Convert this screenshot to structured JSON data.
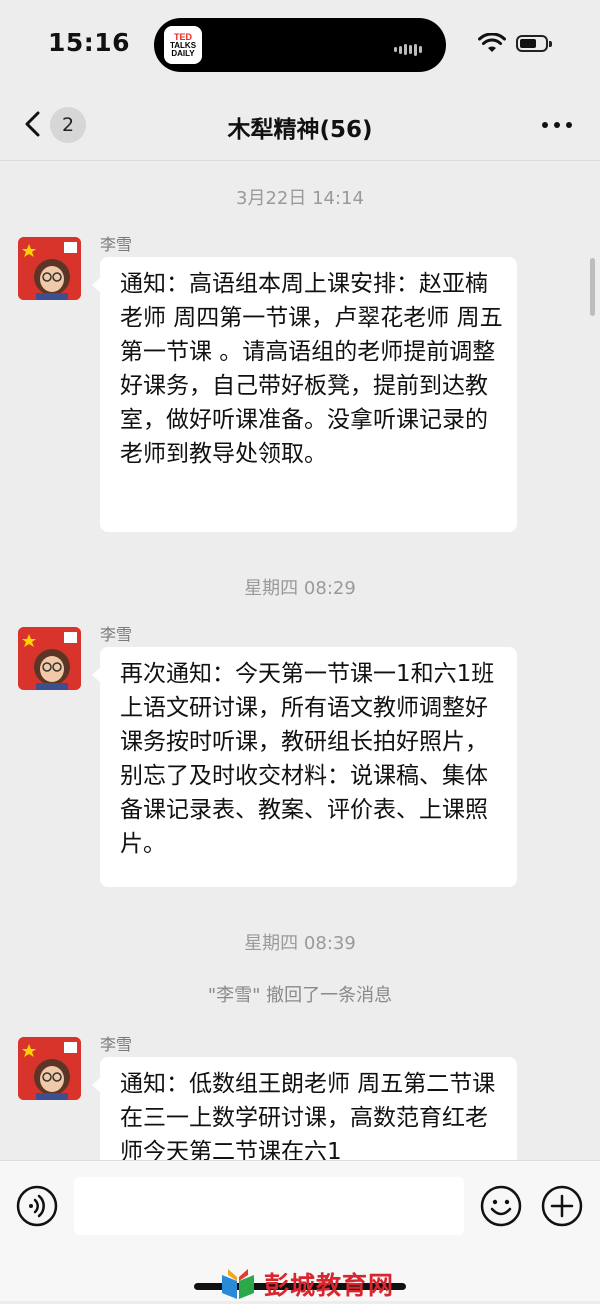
{
  "status_bar": {
    "time": "15:16",
    "island_logo": [
      "TED",
      "TALKS",
      "DAILY"
    ]
  },
  "header": {
    "back_badge": "2",
    "title": "木犁精神(56)"
  },
  "messages": [
    {
      "timestamp": "3月22日 14:14",
      "sender": "李雪",
      "text": "通知：高语组本周上课安排：赵亚楠老师 周四第一节课，卢翠花老师 周五第一节课 。请高语组的老师提前调整好课务，自己带好板凳，提前到达教室，做好听课准备。没拿听课记录的老师到教导处领取。"
    },
    {
      "timestamp": "星期四 08:29",
      "sender": "李雪",
      "text": "再次通知：今天第一节课一1和六1班上语文研讨课，所有语文教师调整好课务按时听课，教研组长拍好照片，别忘了及时收交材料：说课稿、集体备课记录表、教案、评价表、上课照片。"
    },
    {
      "timestamp": "星期四 08:39",
      "system": "\"李雪\" 撤回了一条消息"
    },
    {
      "sender": "李雪",
      "text": "通知：低数组王朗老师 周五第二节课在三一上数学研讨课，高数范育红老师今天第二节课在六1"
    }
  ],
  "input_bar": {
    "placeholder": ""
  },
  "watermark": {
    "text": "彭城教育网"
  },
  "colors": {
    "background": "#ededed",
    "bubble": "#ffffff",
    "timestamp": "#9a9a9a",
    "watermark": "#d8262e"
  }
}
